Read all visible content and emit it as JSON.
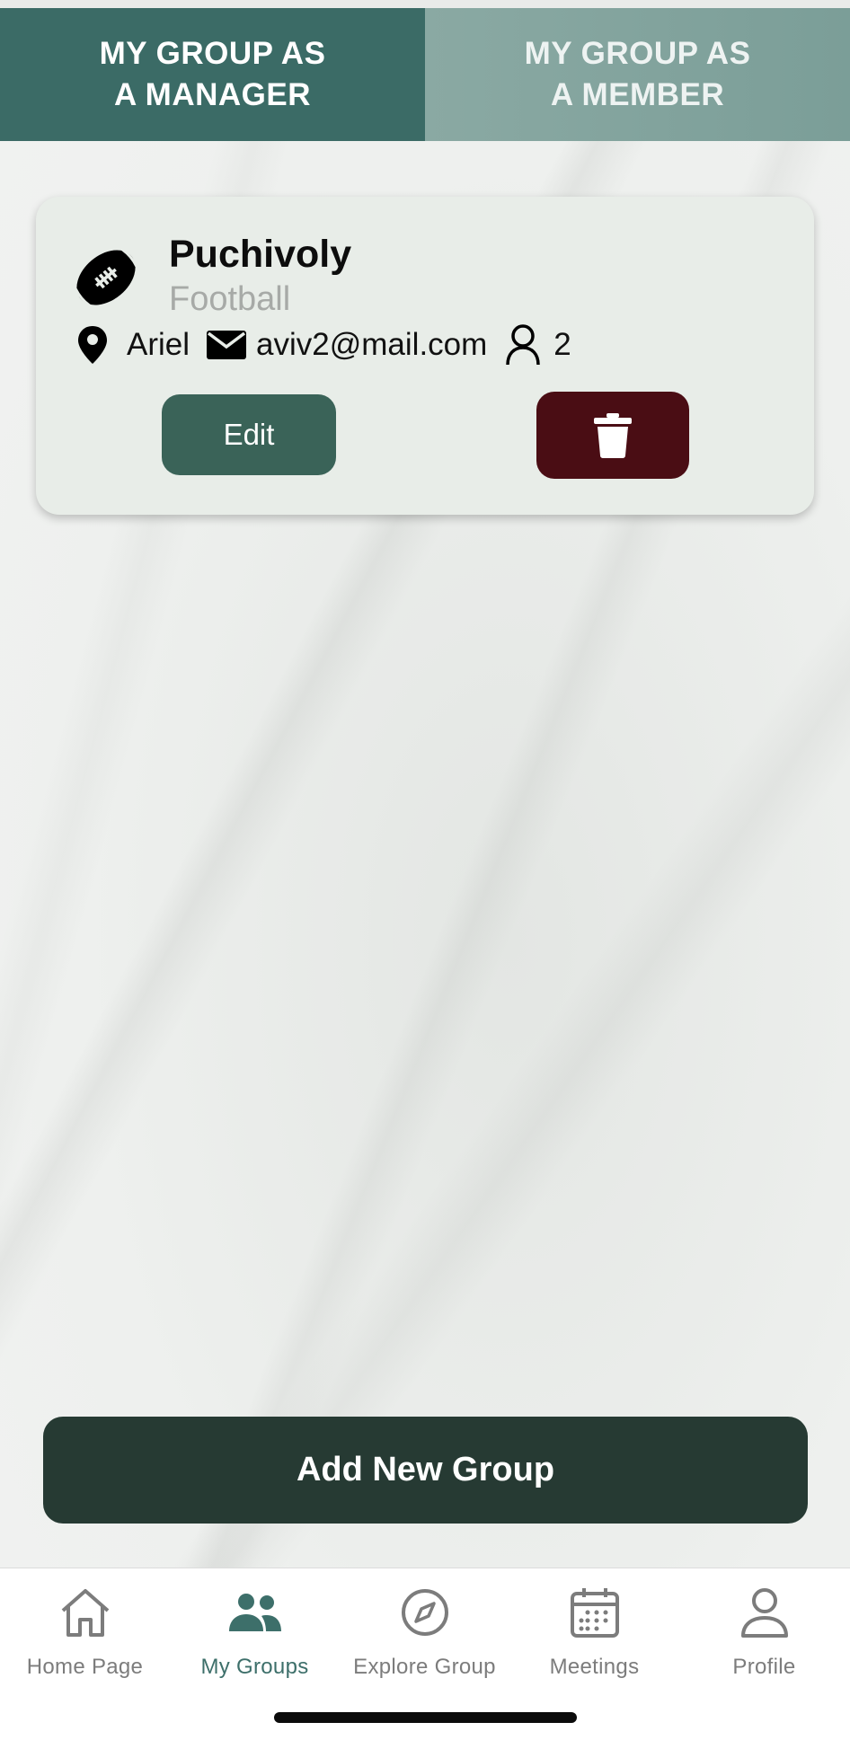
{
  "tabs": [
    {
      "label": "MY GROUP AS\nA MANAGER",
      "active": true
    },
    {
      "label": "MY GROUP AS\nA MEMBER",
      "active": false
    }
  ],
  "group_card": {
    "name": "Puchivoly",
    "sport": "Football",
    "sport_icon": "football-icon",
    "location": "Ariel",
    "email": "aviv2@mail.com",
    "members": "2",
    "edit_label": "Edit",
    "delete_icon": "trash-icon"
  },
  "add_button_label": "Add New Group",
  "bottom_nav": [
    {
      "label": "Home Page",
      "icon": "home-icon"
    },
    {
      "label": "My Groups",
      "icon": "groups-icon",
      "active": true
    },
    {
      "label": "Explore Group",
      "icon": "compass-icon"
    },
    {
      "label": "Meetings",
      "icon": "calendar-icon"
    },
    {
      "label": "Profile",
      "icon": "person-icon"
    }
  ],
  "colors": {
    "tab_active": "#3b6b66",
    "tab_inactive": "#85a59f",
    "edit_button": "#3a6358",
    "delete_button": "#4a0d14",
    "add_button": "#263a33",
    "nav_active": "#3d6f6a",
    "nav_inactive": "#7c7c7c"
  }
}
